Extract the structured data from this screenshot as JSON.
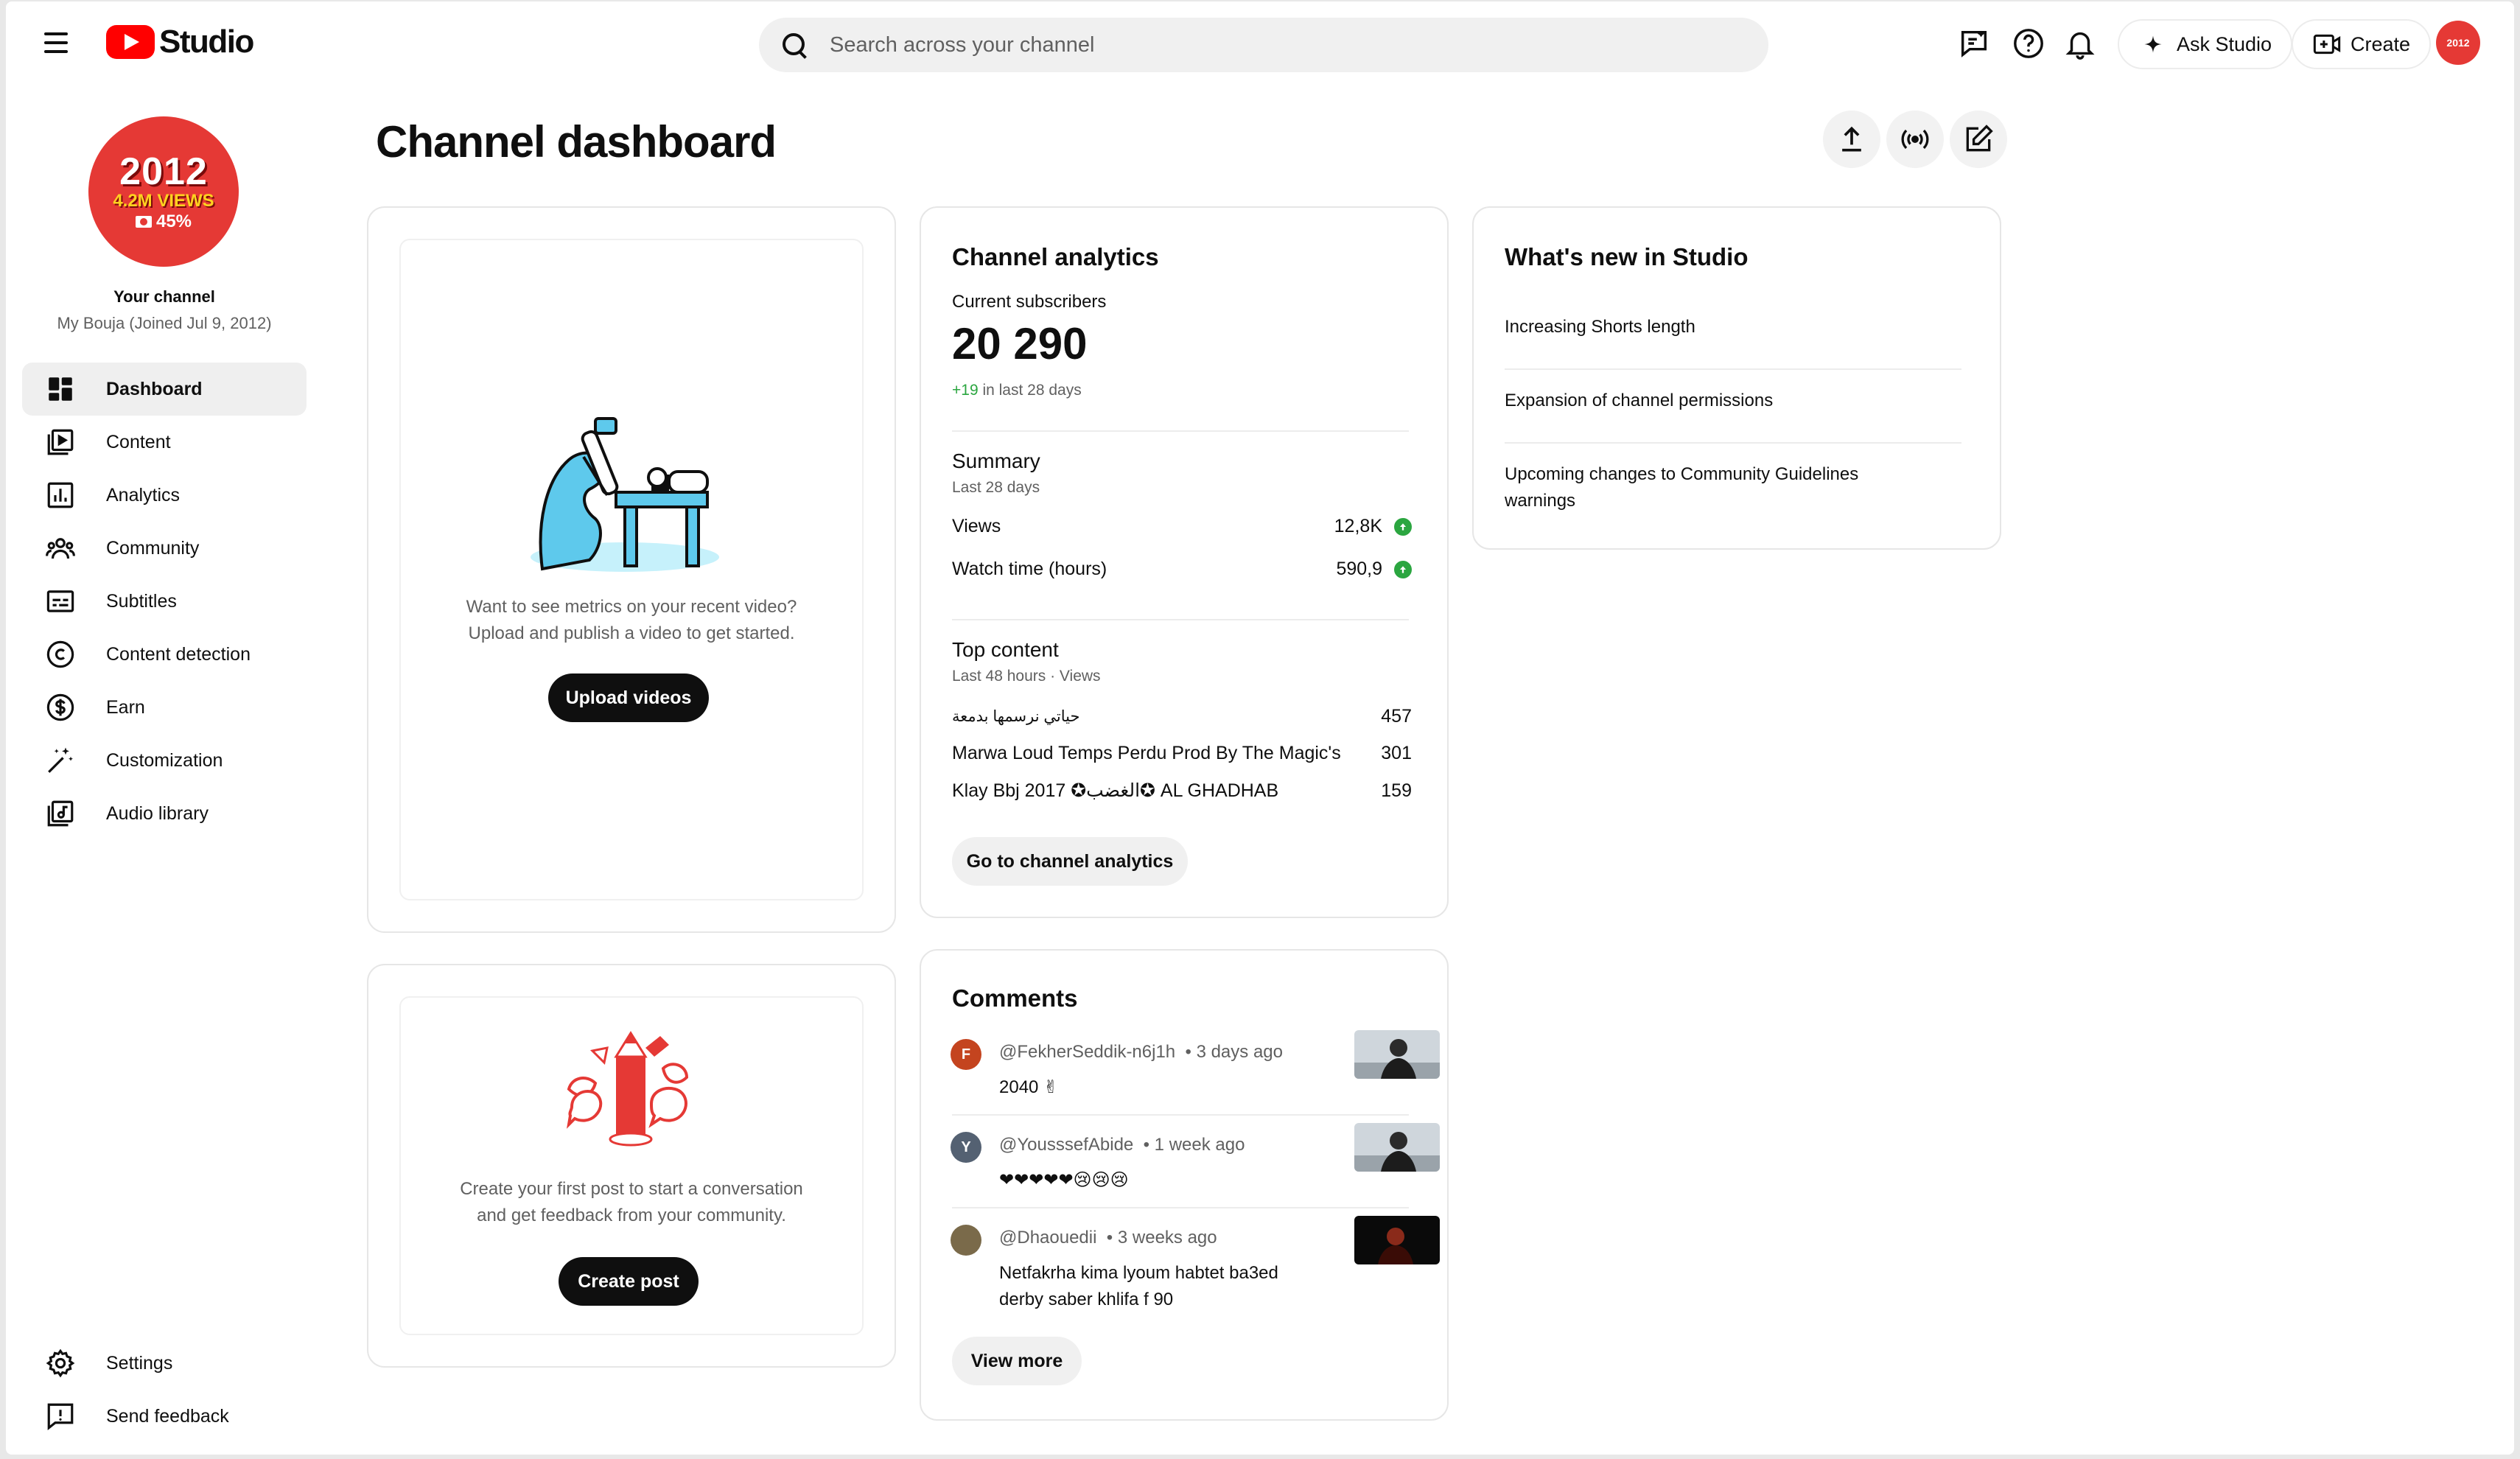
{
  "header": {
    "logo_text": "Studio",
    "search_placeholder": "Search across your channel",
    "ask_studio_label": "Ask Studio",
    "create_label": "Create",
    "avatar_text": "2012"
  },
  "channel": {
    "avatar_year": "2012",
    "avatar_views": "4.2M VIEWS",
    "avatar_percent": "45%",
    "label": "Your channel",
    "subtitle": "My Bouja (Joined Jul 9, 2012)"
  },
  "sidebar": {
    "items": [
      {
        "label": "Dashboard",
        "icon": "dashboard-icon",
        "active": true
      },
      {
        "label": "Content",
        "icon": "content-icon"
      },
      {
        "label": "Analytics",
        "icon": "analytics-icon"
      },
      {
        "label": "Community",
        "icon": "community-icon"
      },
      {
        "label": "Subtitles",
        "icon": "subtitles-icon"
      },
      {
        "label": "Content detection",
        "icon": "copyright-icon"
      },
      {
        "label": "Earn",
        "icon": "dollar-icon"
      },
      {
        "label": "Customization",
        "icon": "magic-wand-icon"
      },
      {
        "label": "Audio library",
        "icon": "audio-library-icon"
      }
    ],
    "bottom": [
      {
        "label": "Settings",
        "icon": "gear-icon"
      },
      {
        "label": "Send feedback",
        "icon": "feedback-icon"
      }
    ]
  },
  "page": {
    "title": "Channel dashboard"
  },
  "upload_card": {
    "text_line1": "Want to see metrics on your recent video?",
    "text_line2": "Upload and publish a video to get started.",
    "button": "Upload videos"
  },
  "post_card": {
    "text_line1": "Create your first post to start a conversation",
    "text_line2": "and get feedback from your community.",
    "button": "Create post"
  },
  "analytics": {
    "title": "Channel analytics",
    "subscribers_label": "Current subscribers",
    "subscribers_value": "20 290",
    "subscribers_delta": "+19",
    "subscribers_period": " in last 28 days",
    "summary_title": "Summary",
    "summary_period": "Last 28 days",
    "summary_rows": [
      {
        "label": "Views",
        "value": "12,8K"
      },
      {
        "label": "Watch time (hours)",
        "value": "590,9"
      }
    ],
    "top_title": "Top content",
    "top_period": "Last 48 hours · Views",
    "top_rows": [
      {
        "label": "حياتي نرسمها بدمعة",
        "value": "457"
      },
      {
        "label": "Marwa Loud Temps Perdu Prod By The Magic's",
        "value": "301"
      },
      {
        "label": "Klay Bbj 2017 ✪الغضب✪ AL GHADHAB",
        "value": "159"
      }
    ],
    "button": "Go to channel analytics"
  },
  "comments": {
    "title": "Comments",
    "items": [
      {
        "initial": "F",
        "color": "#c4441f",
        "author": "@FekherSeddik-n6j1h",
        "time": "• 3 days ago",
        "text": "2040 ✌"
      },
      {
        "initial": "Y",
        "color": "#546172",
        "author": "@YousssefAbide",
        "time": "• 1 week ago",
        "text": "❤❤❤❤❤😢😢😢"
      },
      {
        "initial": "",
        "color": "#7a6a4a",
        "author": "@Dhaouedii",
        "time": "• 3 weeks ago",
        "text": "Netfakrha kima lyoum habtet ba3ed derby saber khlifa f 90"
      }
    ],
    "button": "View more"
  },
  "news": {
    "title": "What's new in Studio",
    "items": [
      "Increasing Shorts length",
      "Expansion of channel permissions",
      "Upcoming changes to Community Guidelines warnings"
    ]
  }
}
